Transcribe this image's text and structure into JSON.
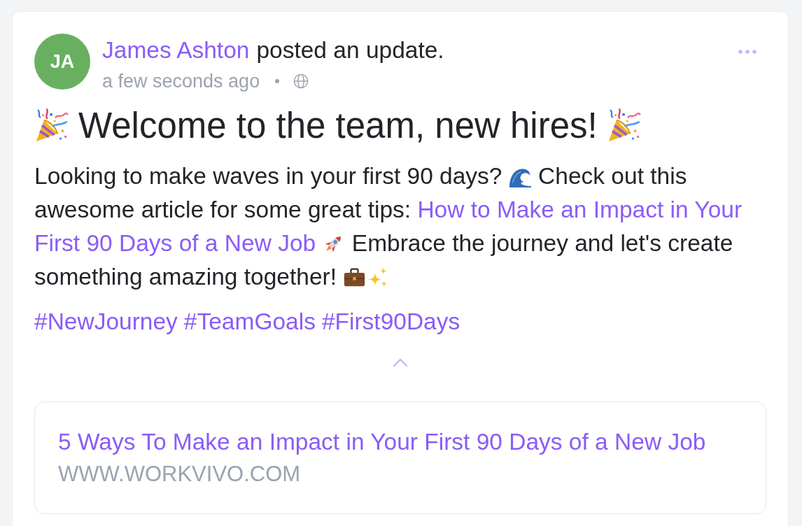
{
  "post": {
    "author": {
      "initials": "JA",
      "name": "James Ashton"
    },
    "action": "posted an update.",
    "time": "a few seconds ago",
    "title": "Welcome to the team, new hires!",
    "body": [
      {
        "kind": "text",
        "text": "Looking to make waves in your first 90 days?"
      },
      {
        "kind": "emoji"
      },
      {
        "kind": "text",
        "text": "Check out this awesome article for some great tips:"
      },
      {
        "kind": "link",
        "text": "How to Make an Impact in Your"
      },
      {
        "kind": "link",
        "text": "First 90 Days of a New Job"
      },
      {
        "kind": "emoji"
      },
      {
        "kind": "text",
        "text": "Embrace the journey and let's create something amazing together!"
      },
      {
        "kind": "emoji"
      },
      {
        "kind": "emoji"
      }
    ],
    "hashtags": [
      "#NewJourney",
      "#TeamGoals",
      "#First90Days"
    ],
    "link_preview": {
      "title": "5 Ways To Make an Impact in Your First 90 Days of a New Job",
      "domain": "WWW.WORKVIVO.COM"
    }
  }
}
